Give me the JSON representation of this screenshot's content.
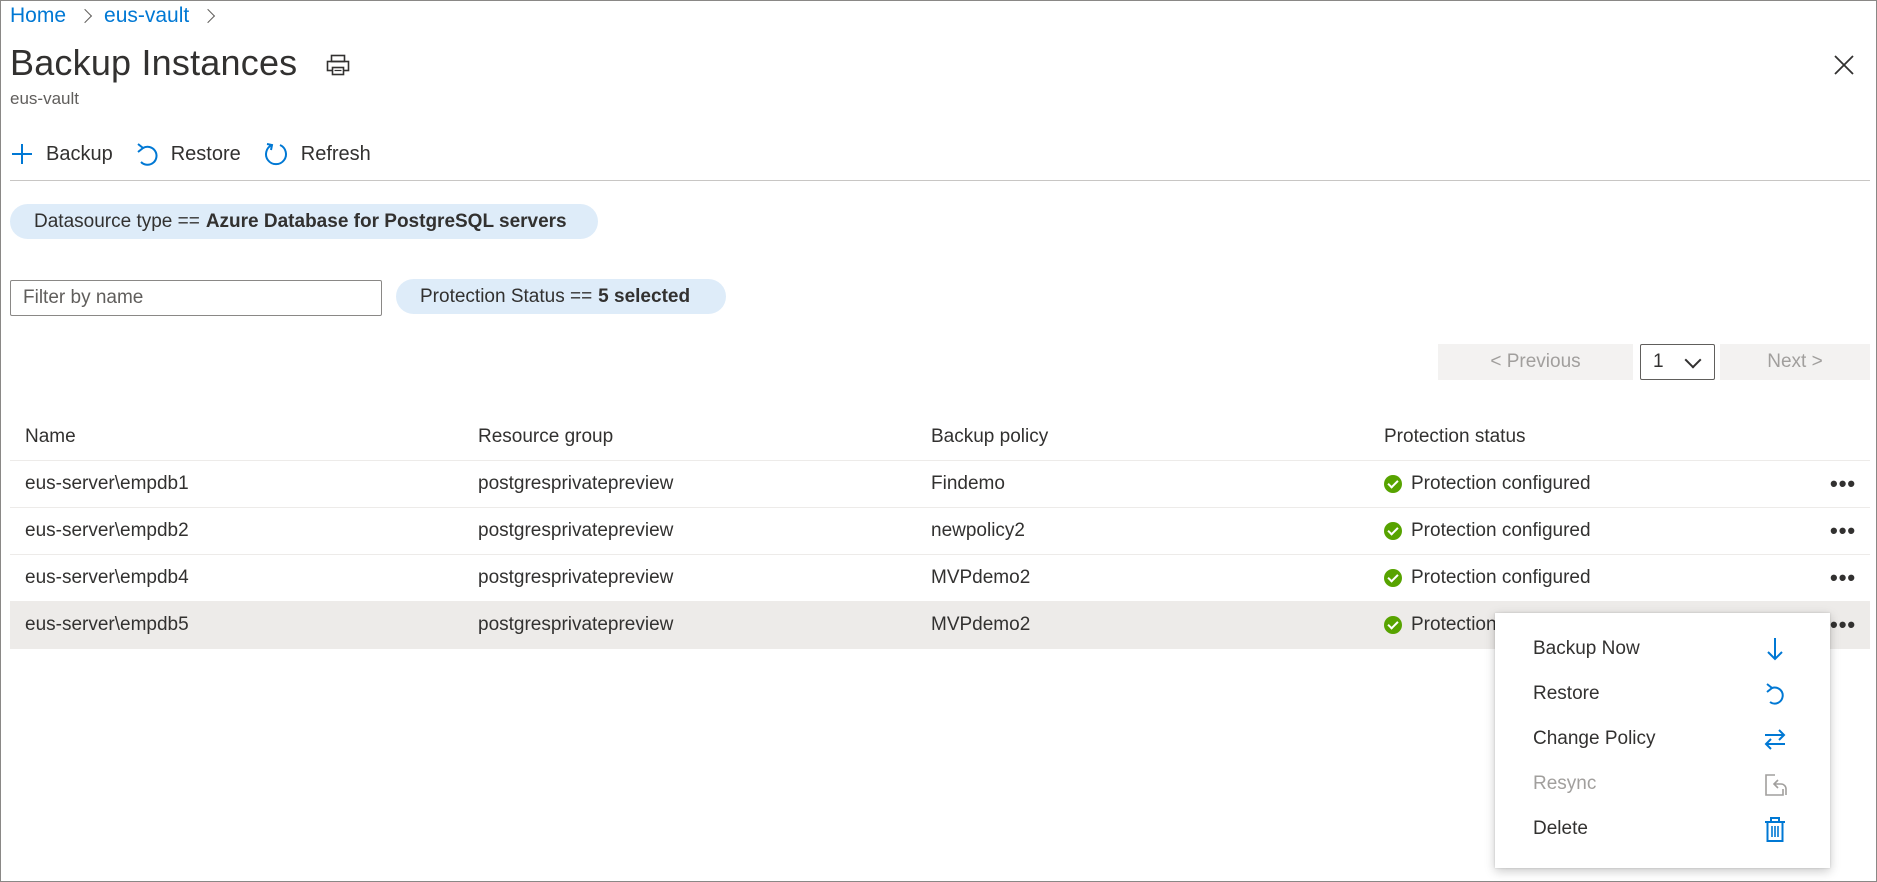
{
  "breadcrumb": {
    "items": [
      "Home",
      "eus-vault"
    ]
  },
  "header": {
    "title": "Backup Instances",
    "subtitle": "eus-vault"
  },
  "icons": {
    "print": "print-icon",
    "close": "close-icon"
  },
  "toolbar": {
    "backup_label": "Backup",
    "restore_label": "Restore",
    "refresh_label": "Refresh"
  },
  "filters": {
    "datasource_prefix": "Datasource type ==",
    "datasource_value": "Azure Database for PostgreSQL servers",
    "search_placeholder": "Filter by name",
    "search_value": "",
    "status_prefix": "Protection Status ==",
    "status_value": "5 selected"
  },
  "pager": {
    "previous": "< Previous",
    "page": "1",
    "next": "Next >"
  },
  "table": {
    "columns": [
      "Name",
      "Resource group",
      "Backup policy",
      "Protection status"
    ],
    "rows": [
      {
        "name": "eus-server\\empdb1",
        "group": "postgresprivatepreview",
        "policy": "Findemo",
        "status": "Protection configured"
      },
      {
        "name": "eus-server\\empdb2",
        "group": "postgresprivatepreview",
        "policy": "newpolicy2",
        "status": "Protection configured"
      },
      {
        "name": "eus-server\\empdb4",
        "group": "postgresprivatepreview",
        "policy": "MVPdemo2",
        "status": "Protection configured"
      },
      {
        "name": "eus-server\\empdb5",
        "group": "postgresprivatepreview",
        "policy": "MVPdemo2",
        "status": "Protection"
      }
    ],
    "more_label": "•••"
  },
  "context_menu": {
    "items": [
      {
        "label": "Backup Now",
        "icon": "arrow-down-icon",
        "enabled": true
      },
      {
        "label": "Restore",
        "icon": "restore-icon",
        "enabled": true
      },
      {
        "label": "Change Policy",
        "icon": "swap-arrows-icon",
        "enabled": true
      },
      {
        "label": "Resync",
        "icon": "resync-icon",
        "enabled": false
      },
      {
        "label": "Delete",
        "icon": "trash-icon",
        "enabled": true
      }
    ]
  },
  "colors": {
    "accent": "#0078d4",
    "success": "#57a300",
    "pill": "#deecf9",
    "selected_row": "#edebe9"
  }
}
